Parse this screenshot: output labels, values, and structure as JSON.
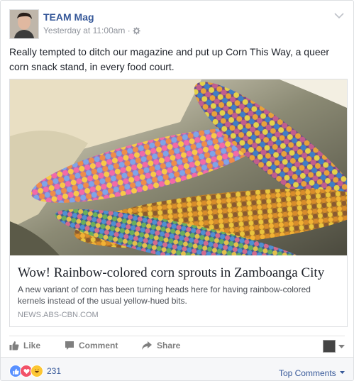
{
  "post": {
    "author": "TEAM Mag",
    "timestamp": "Yesterday at 11:00am",
    "separator": "·",
    "privacy_icon": "gear-icon",
    "text": "Really tempted to ditch our magazine and put up Corn This Way, a queer corn snack stand, in every food court."
  },
  "link": {
    "title": "Wow! Rainbow-colored corn sprouts in Zamboanga City",
    "description": "A new variant of corn has been turning heads here for having rainbow-colored kernels instead of the usual yellow-hued bits.",
    "domain": "NEWS.ABS-CBN.COM"
  },
  "actions": {
    "like": "Like",
    "comment": "Comment",
    "share": "Share"
  },
  "footer": {
    "reaction_count": "231",
    "top_comments": "Top Comments"
  },
  "colors": {
    "link_blue": "#365899",
    "like_blue": "#5890ff",
    "love_red": "#f25268",
    "haha_yellow": "#fcc633"
  }
}
